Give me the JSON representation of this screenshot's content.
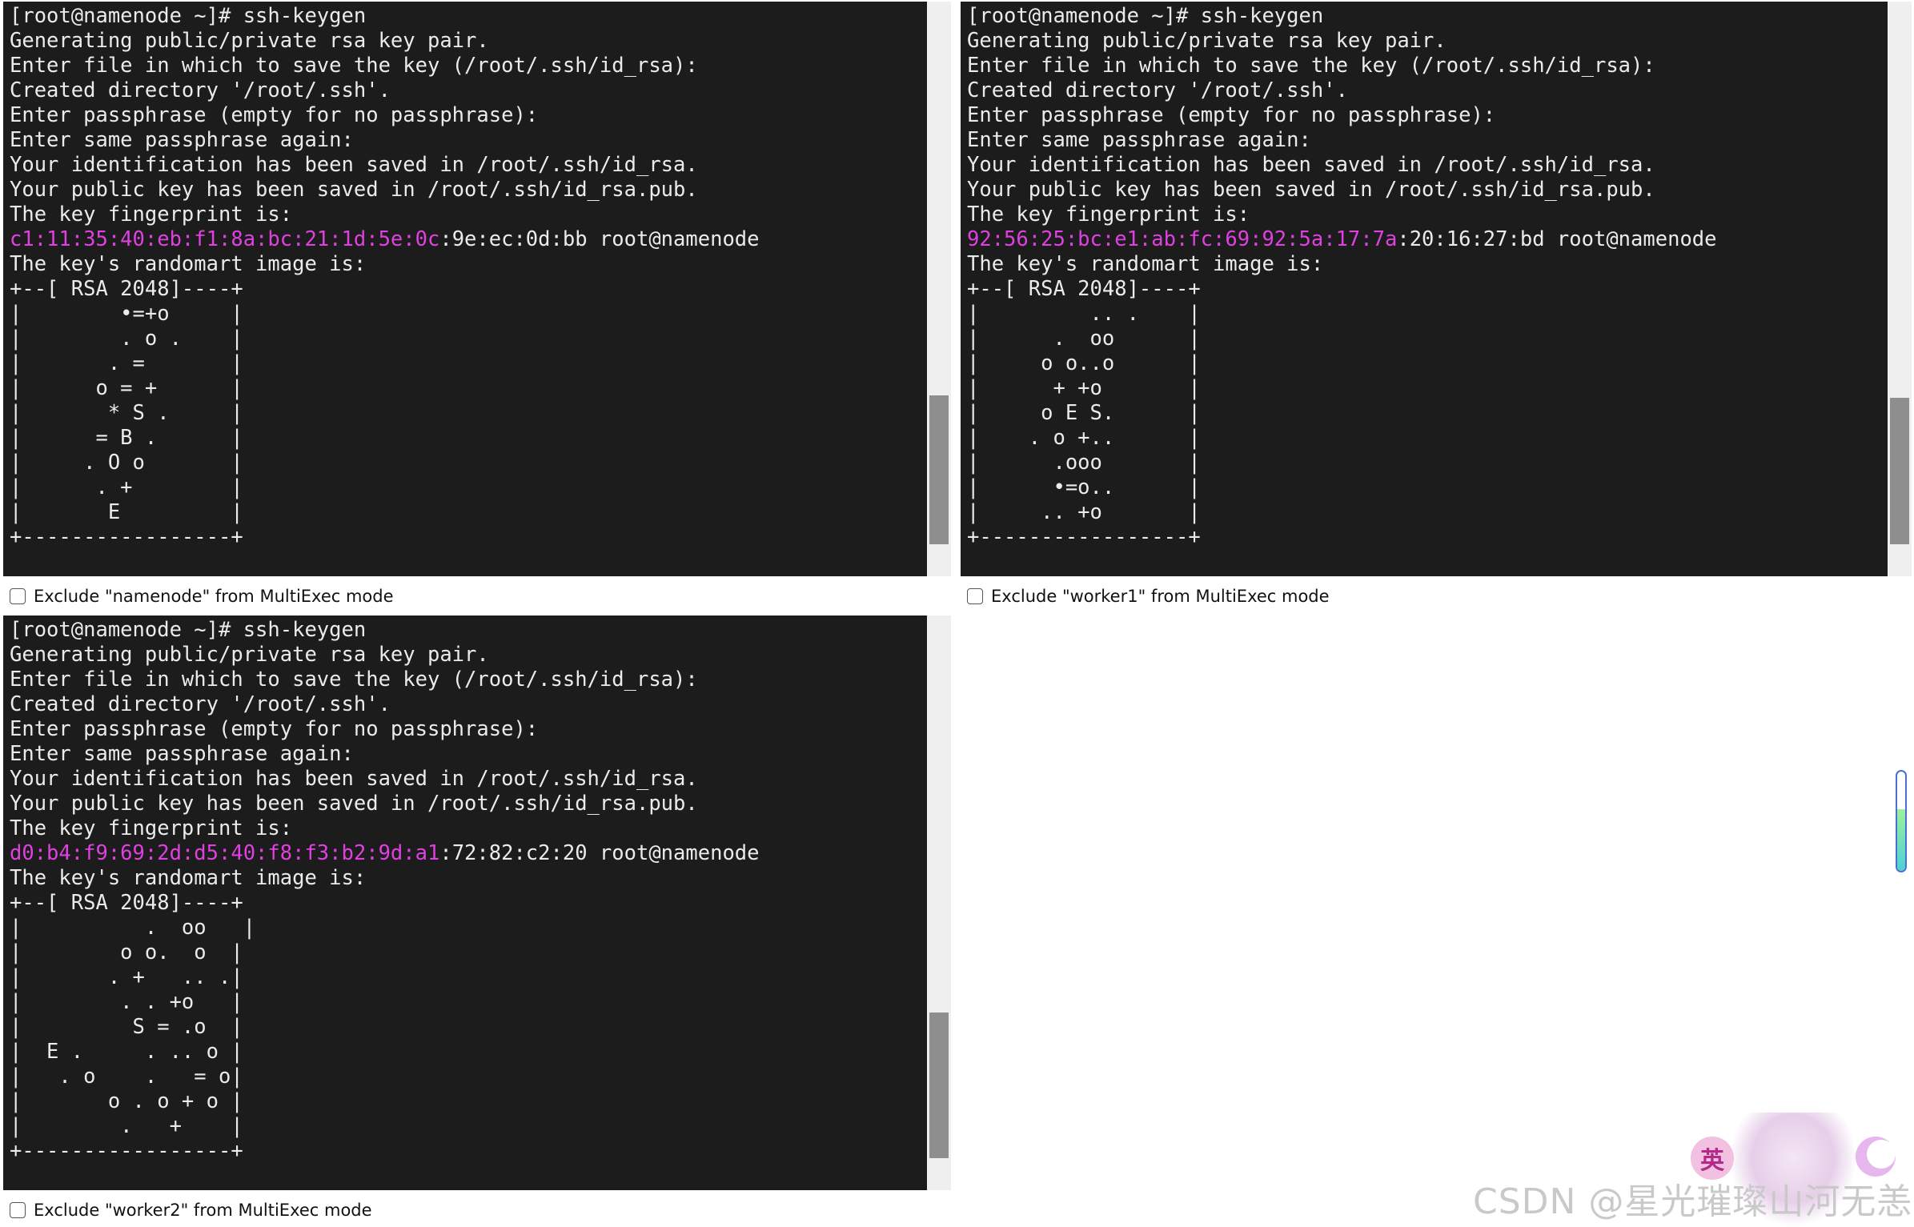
{
  "panes": [
    {
      "id": "namenode",
      "lines": [
        {
          "text": "[root@namenode ~]# ssh-keygen"
        },
        {
          "text": "Generating public/private rsa key pair."
        },
        {
          "text": "Enter file in which to save the key (/root/.ssh/id_rsa):"
        },
        {
          "text": "Created directory '/root/.ssh'."
        },
        {
          "text": "Enter passphrase (empty for no passphrase):"
        },
        {
          "text": "Enter same passphrase again:"
        },
        {
          "text": "Your identification has been saved in /root/.ssh/id_rsa."
        },
        {
          "text": "Your public key has been saved in /root/.ssh/id_rsa.pub."
        },
        {
          "text": "The key fingerprint is:"
        },
        {
          "highlight": "c1:11:35:40:eb:f1:8a:bc:21:1d:5e:0c",
          "text": ":9e:ec:0d:bb root@namenode"
        },
        {
          "text": "The key's randomart image is:"
        },
        {
          "text": "+--[ RSA 2048]----+"
        },
        {
          "text": "|        •=+o     |"
        },
        {
          "text": "|        . o .    |"
        },
        {
          "text": "|       . =       |"
        },
        {
          "text": "|      o = +      |"
        },
        {
          "text": "|       * S .     |"
        },
        {
          "text": "|      = B .      |"
        },
        {
          "text": "|     . O o       |"
        },
        {
          "text": "|      . +        |"
        },
        {
          "text": "|       E         |"
        },
        {
          "text": "+-----------------+"
        }
      ],
      "exclude_label": "Exclude \"namenode\" from MultiExec mode",
      "scroll_position": 0.82
    },
    {
      "id": "worker1",
      "lines": [
        {
          "text": "[root@namenode ~]# ssh-keygen"
        },
        {
          "text": "Generating public/private rsa key pair."
        },
        {
          "text": "Enter file in which to save the key (/root/.ssh/id_rsa):"
        },
        {
          "text": "Created directory '/root/.ssh'."
        },
        {
          "text": "Enter passphrase (empty for no passphrase):"
        },
        {
          "text": "Enter same passphrase again:"
        },
        {
          "text": "Your identification has been saved in /root/.ssh/id_rsa."
        },
        {
          "text": "Your public key has been saved in /root/.ssh/id_rsa.pub."
        },
        {
          "text": "The key fingerprint is:"
        },
        {
          "highlight": "92:56:25:bc:e1:ab:fc:69:92:5a:17:7a",
          "text": ":20:16:27:bd root@namenode"
        },
        {
          "text": "The key's randomart image is:"
        },
        {
          "text": "+--[ RSA 2048]----+"
        },
        {
          "text": "|         .. .    |"
        },
        {
          "text": "|      .  oo      |"
        },
        {
          "text": "|     o o..o      |"
        },
        {
          "text": "|      + +o       |"
        },
        {
          "text": "|     o E S.      |"
        },
        {
          "text": "|    . o +..      |"
        },
        {
          "text": "|      .ooo       |"
        },
        {
          "text": "|      •=o..      |"
        },
        {
          "text": "|     .. +o       |"
        },
        {
          "text": "+-----------------+"
        }
      ],
      "exclude_label": "Exclude \"worker1\" from MultiExec mode",
      "scroll_position": 0.82
    },
    {
      "id": "worker2",
      "lines": [
        {
          "text": "[root@namenode ~]# ssh-keygen"
        },
        {
          "text": "Generating public/private rsa key pair."
        },
        {
          "text": "Enter file in which to save the key (/root/.ssh/id_rsa):"
        },
        {
          "text": "Created directory '/root/.ssh'."
        },
        {
          "text": "Enter passphrase (empty for no passphrase):"
        },
        {
          "text": "Enter same passphrase again:"
        },
        {
          "text": "Your identification has been saved in /root/.ssh/id_rsa."
        },
        {
          "text": "Your public key has been saved in /root/.ssh/id_rsa.pub."
        },
        {
          "text": "The key fingerprint is:"
        },
        {
          "highlight": "d0:b4:f9:69:2d:d5:40:f8:f3:b2:9d:a1",
          "text": ":72:82:c2:20 root@namenode"
        },
        {
          "text": "The key's randomart image is:"
        },
        {
          "text": "+--[ RSA 2048]----+"
        },
        {
          "text": "|          .  oo   |"
        },
        {
          "text": "|        o o.  o  |"
        },
        {
          "text": "|       . +   .. .|"
        },
        {
          "text": "|        . . +o   |"
        },
        {
          "text": "|         S = .o  |"
        },
        {
          "text": "|  E .     . .. o |"
        },
        {
          "text": "|   . o    .   = o|"
        },
        {
          "text": "|       o . o + o |"
        },
        {
          "text": "|        .   +    |"
        },
        {
          "text": "+-----------------+"
        }
      ],
      "exclude_label": "Exclude \"worker2\" from MultiExec mode",
      "scroll_position": 0.82
    }
  ],
  "tray": {
    "ime_indicator": "英",
    "meter_level": 0.62,
    "moon_icon": "moon-icon"
  },
  "watermark": "CSDN @星光璀璨山河无恙",
  "colors": {
    "terminal_bg": "#1c1c1c",
    "terminal_fg": "#ebebeb",
    "fingerprint_highlight": "#e040e0"
  }
}
